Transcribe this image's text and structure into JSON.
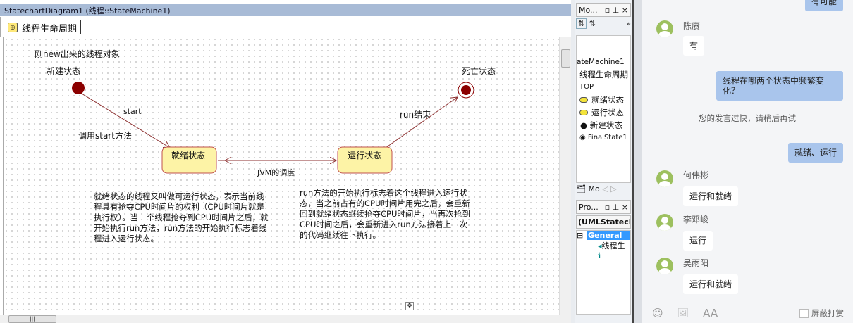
{
  "editor": {
    "title": "StatechartDiagram1 (线程::StateMachine1)",
    "tab": "线程生命周期",
    "diagram": {
      "note_new_object": "刚new出来的线程对象",
      "label_new_state": "新建状态",
      "label_dead_state": "死亡状态",
      "state_ready": "就绪状态",
      "state_running": "运行状态",
      "transition_start": "start",
      "note_call_start": "调用start方法",
      "transition_jvm": "JVM的调度",
      "transition_run_end": "run结束",
      "note_ready": "就绪状态的线程又叫做可运行状态，表示当前线程具有抢夺CPU时间片的权利（CPU时间片就是执行权）。当一个线程抢夺到CPU时间片之后，就开始执行run方法，run方法的开始执行标志着线程进入运行状态。",
      "note_running": "run方法的开始执行标志着这个线程进入运行状态，当之前占有的CPU时间片用完之后，会重新回到就绪状态继续抢夺CPU时间片，当再次抢到CPU时间之后，会重新进入run方法接着上一次的代码继续往下执行。",
      "state_color": "#fdf3a6",
      "state_border": "#c0504d",
      "pseudo_color": "#8b0000"
    }
  },
  "model_panel": {
    "title": "Mo...",
    "tree": [
      "ateMachine1",
      "线程生命周期",
      "TOP",
      "就绪状态",
      "运行状态",
      "新建状态",
      "FinalState1"
    ],
    "tab": "Mo"
  },
  "properties_panel": {
    "title": "Pro...",
    "selector": "(UMLStatecha",
    "group": "General",
    "item": "线程生"
  },
  "chat": {
    "messages": [
      {
        "type": "me",
        "text": "有可能"
      },
      {
        "type": "other",
        "name": "陈赓",
        "text": "有"
      },
      {
        "type": "me",
        "text": "线程在哪两个状态中频繁变化？"
      },
      {
        "type": "system",
        "text": "您的发言过快，请稍后再试"
      },
      {
        "type": "me",
        "text": "就绪、运行"
      },
      {
        "type": "other",
        "name": "何伟彬",
        "text": "运行和就绪"
      },
      {
        "type": "other",
        "name": "李邓峻",
        "text": "运行"
      },
      {
        "type": "other",
        "name": "吴雨阳",
        "text": "运行和就绪"
      }
    ],
    "toolbar": {
      "emoji": "☺",
      "image": "🖼",
      "font": "AA",
      "block_tips": "屏蔽打赏"
    }
  }
}
